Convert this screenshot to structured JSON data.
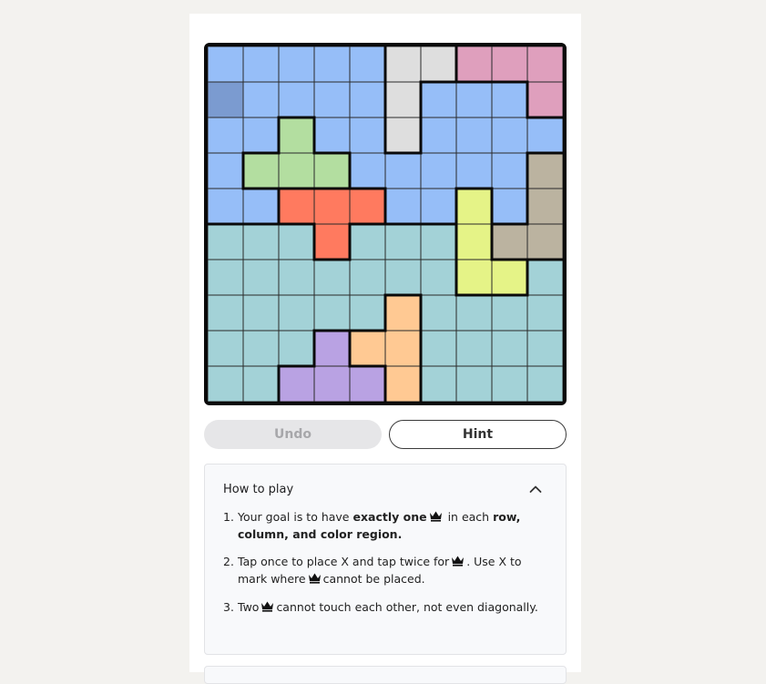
{
  "board": {
    "size": 10,
    "colors": {
      "A": "#96bef8",
      "B": "#dedede",
      "C": "#df9fbd",
      "D": "#b3dea0",
      "E": "#bbb3a0",
      "F": "#ff7a5f",
      "G": "#e5f387",
      "H": "#a3d2d7",
      "I": "#ffc993",
      "J": "#b9a2e3",
      "selected": "#7b9bd0"
    },
    "regions": [
      "AAAAABBCCC",
      "AAAAABAAAC",
      "AADAABAAAA",
      "ADDDAAAAAE",
      "AAFFFAAGAE",
      "HHHFHHHGEE",
      "HHHHHHHGGH",
      "HHHHHIHHHH",
      "HHHJIIHHHH",
      "HHJJJIHHHH"
    ],
    "highlighted_cell": [
      1,
      0
    ]
  },
  "buttons": {
    "undo": "Undo",
    "hint": "Hint"
  },
  "how_to_play": {
    "title": "How to play",
    "rules": [
      {
        "num": "1.",
        "parts": [
          "Your goal is to have ",
          "exactly one",
          " in each ",
          "row, column, and color region."
        ]
      },
      {
        "num": "2.",
        "parts": [
          "Tap once to place X and tap twice for",
          ". Use X to mark where",
          "cannot be placed."
        ]
      },
      {
        "num": "3.",
        "parts": [
          "Two",
          "cannot touch each other, not even diagonally."
        ]
      }
    ]
  },
  "icons": [
    "crown-icon",
    "chevron-up-icon"
  ]
}
